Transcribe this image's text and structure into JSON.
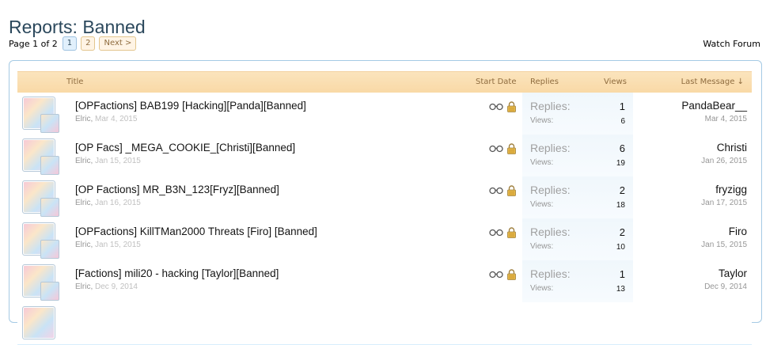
{
  "page_title": "Reports: Banned",
  "pagination": {
    "label": "Page 1 of 2",
    "pages": [
      "1",
      "2"
    ],
    "next": "Next >"
  },
  "watch_forum": "Watch Forum",
  "headers": {
    "title": "Title",
    "start_date": "Start Date",
    "replies": "Replies",
    "views": "Views",
    "last_message": "Last Message ↓"
  },
  "labels": {
    "replies": "Replies:",
    "views": "Views:"
  },
  "threads": [
    {
      "title": "[OPFactions] BAB199 [Hacking][Panda][Banned]",
      "author": "Elric",
      "start": "Mar 4, 2015",
      "replies": "1",
      "views": "6",
      "last_user": "PandaBear__",
      "last_date": "Mar 4, 2015"
    },
    {
      "title": "[OP Facs] _MEGA_COOKIE_[Christi][Banned]",
      "author": "Elric",
      "start": "Jan 15, 2015",
      "replies": "6",
      "views": "19",
      "last_user": "Christi",
      "last_date": "Jan 26, 2015"
    },
    {
      "title": "[OP Factions] MR_B3N_123[Fryz][Banned]",
      "author": "Elric",
      "start": "Jan 16, 2015",
      "replies": "2",
      "views": "18",
      "last_user": "fryzigg",
      "last_date": "Jan 17, 2015"
    },
    {
      "title": "[OPFactions] KillTMan2000 Threats [Firo] [Banned]",
      "author": "Elric",
      "start": "Jan 15, 2015",
      "replies": "2",
      "views": "10",
      "last_user": "Firo",
      "last_date": "Jan 15, 2015"
    },
    {
      "title": "[Factions] mili20 - hacking [Taylor][Banned]",
      "author": "Elric",
      "start": "Dec 9, 2014",
      "replies": "1",
      "views": "13",
      "last_user": "Taylor",
      "last_date": "Dec 9, 2014"
    }
  ],
  "colors": {
    "accent": "#2b485c",
    "header_bg": "#f9d9a6",
    "border": "#a5cae4"
  }
}
